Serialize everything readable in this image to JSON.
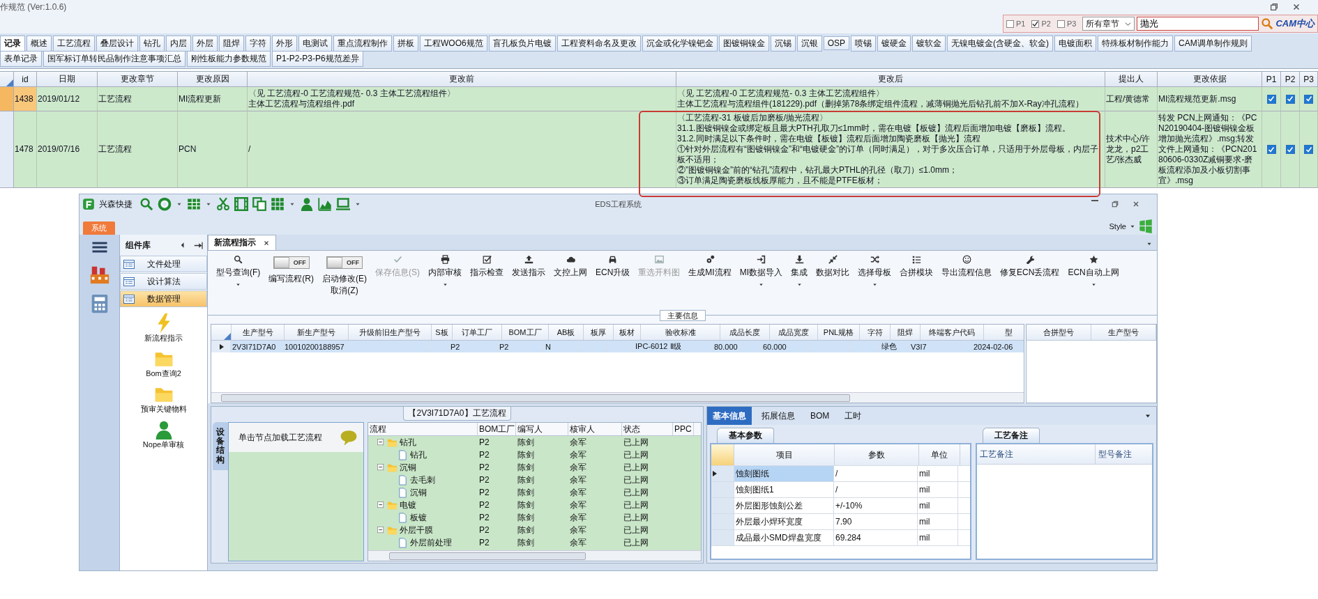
{
  "window": {
    "title": "作规范 (Ver:1.0.6)"
  },
  "filter": {
    "checks": [
      {
        "label": "P1",
        "checked": false
      },
      {
        "label": "P2",
        "checked": true
      },
      {
        "label": "P3",
        "checked": false
      }
    ],
    "chapter": "所有章节",
    "search_value": "抛光",
    "logo": "CAM中心"
  },
  "tab_rows": [
    {
      "tabs": [
        {
          "label": "记录",
          "selected": true
        },
        {
          "label": "概述",
          "selected": false
        },
        {
          "label": "工艺流程",
          "selected": false
        },
        {
          "label": "叠层设计",
          "selected": false
        },
        {
          "label": "钻孔",
          "selected": false
        },
        {
          "label": "内层",
          "selected": false
        },
        {
          "label": "外层",
          "selected": false
        },
        {
          "label": "阻焊",
          "selected": false
        },
        {
          "label": "字符",
          "selected": false
        },
        {
          "label": "外形",
          "selected": false
        },
        {
          "label": "电测试",
          "selected": false
        },
        {
          "label": "重点流程制作",
          "selected": false
        },
        {
          "label": "拼板",
          "selected": false
        },
        {
          "label": "工程WOO6规范",
          "selected": false
        },
        {
          "label": "盲孔板负片电镀",
          "selected": false
        },
        {
          "label": "工程资料命名及更改",
          "selected": false
        },
        {
          "label": "沉金或化学镍钯金",
          "selected": false
        },
        {
          "label": "图镀铜镍金",
          "selected": false
        },
        {
          "label": "沉锡",
          "selected": false
        },
        {
          "label": "沉银",
          "selected": false
        },
        {
          "label": "OSP",
          "selected": false
        },
        {
          "label": "喷锡",
          "selected": false
        },
        {
          "label": "镀硬金",
          "selected": false
        },
        {
          "label": "镀软金",
          "selected": false
        },
        {
          "label": "无镍电镀金(含硬金、软金)",
          "selected": false
        },
        {
          "label": "电镀面积",
          "selected": false
        },
        {
          "label": "特殊板材制作能力",
          "selected": false
        },
        {
          "label": "CAM调单制作规则",
          "selected": false
        }
      ]
    },
    {
      "tabs": [
        {
          "label": "表单记录",
          "selected": false
        },
        {
          "label": "国军标订单转民品制作注意事项汇总",
          "selected": false
        },
        {
          "label": "刚性板能力参数规范",
          "selected": false
        },
        {
          "label": "P1-P2-P3-P6规范差异",
          "selected": false
        }
      ]
    }
  ],
  "table": {
    "columns": [
      "id",
      "日期",
      "更改章节",
      "更改原因",
      "更改前",
      "更改后",
      "提出人",
      "更改依据",
      "P1",
      "P2",
      "P3"
    ],
    "rows": [
      {
        "selected": true,
        "boxed": false,
        "id": "1438",
        "date": "2019/01/12",
        "chapter": "工艺流程",
        "reason": "MI流程更新",
        "before": [
          "〈见 工艺流程-0 工艺流程规范- 0.3 主体工艺流程组件〉",
          "主体工艺流程与流程组件.pdf"
        ],
        "after": [
          "〈见 工艺流程-0 工艺流程规范- 0.3 主体工艺流程组件〉",
          "主体工艺流程与流程组件(181229).pdf（删掉第78条绑定组件流程，减薄铜抛光后钻孔前不加X-Ray冲孔流程）"
        ],
        "proposer": "工程/黄德常",
        "basis": "MI流程规范更新.msg",
        "p1": true,
        "p2": true,
        "p3": true
      },
      {
        "selected": false,
        "boxed": true,
        "id": "1478",
        "date": "2019/07/16",
        "chapter": "工艺流程",
        "reason": "PCN",
        "before": [
          "/"
        ],
        "after": [
          "〈工艺流程-31 板镀后加磨板/抛光流程〉",
          "31.1.图镀铜镍金或绑定板且最大PTH孔取刀≤1mm时，需在电镀【板镀】流程后面增加电镀【磨板】流程。",
          "31.2.同时满足以下条件时，需在电镀【板镀】流程后面增加陶瓷磨板【抛光】流程",
          "①针对外层流程有“图镀铜镍金”和“电镀硬金”的订单（同时满足），对于多次压合订单，只适用于外层母板，内层子板不适用；",
          "②”图镀铜镍金”前的“钻孔”流程中，钻孔最大PTHL的孔径（取刀）≤1.0mm；",
          "③订单满足陶瓷磨板线板厚能力，且不能是PTFE板材；"
        ],
        "proposer": "技术中心/许龙龙，p2工艺/张杰威",
        "basis": "转发 PCN上网通知：《PCN20190404-图镀铜镍金板增加抛光流程》.msg;转发文件上网通知：《PCN20180606-0330Z减铜要求-磨板流程添加及小板切割事宜》.msg",
        "p1": true,
        "p2": true,
        "p3": true
      }
    ]
  },
  "eds": {
    "title": "EDS工程系统",
    "quick_label": "兴森快捷",
    "menu_tab": "系统",
    "style_label": "Style",
    "panel_title": "组件库",
    "nav_items": [
      {
        "label": "文件处理",
        "selected": false
      },
      {
        "label": "设计算法",
        "selected": false
      },
      {
        "label": "数据管理",
        "selected": true
      }
    ],
    "launchers": [
      {
        "label": "新流程指示"
      },
      {
        "label": "Bom查询2"
      },
      {
        "label": "预审关键物料"
      },
      {
        "label": "Nope单审核"
      }
    ],
    "doc_tab": "新流程指示",
    "ribbon": [
      {
        "kind": "button",
        "label": "型号查询(F)",
        "disabled": false,
        "dropdown": true
      },
      {
        "kind": "toggle",
        "label": "编写流程(R)",
        "on": false,
        "state_text": "OFF"
      },
      {
        "kind": "toggle",
        "label": "启动修改(E)\n取消(Z)",
        "on": false,
        "state_text": "OFF"
      },
      {
        "kind": "button",
        "label": "保存信息(S)",
        "disabled": true,
        "dropdown": false
      },
      {
        "kind": "button",
        "label": "内部审核",
        "disabled": false,
        "dropdown": true
      },
      {
        "kind": "button",
        "label": "指示检查",
        "disabled": false,
        "dropdown": false
      },
      {
        "kind": "button",
        "label": "发送指示",
        "disabled": false,
        "dropdown": false
      },
      {
        "kind": "button",
        "label": "文控上网",
        "disabled": false,
        "dropdown": false
      },
      {
        "kind": "button",
        "label": "ECN升级",
        "disabled": false,
        "dropdown": false
      },
      {
        "kind": "button",
        "label": "重选开料图",
        "disabled": true,
        "dropdown": false
      },
      {
        "kind": "button",
        "label": "生成MI流程",
        "disabled": false,
        "dropdown": false
      },
      {
        "kind": "button",
        "label": "MI数据导入",
        "disabled": false,
        "dropdown": true
      },
      {
        "kind": "button",
        "label": "集成",
        "disabled": false,
        "dropdown": true
      },
      {
        "kind": "button",
        "label": "数据对比",
        "disabled": false,
        "dropdown": false
      },
      {
        "kind": "button",
        "label": "选择母板",
        "disabled": false,
        "dropdown": true
      },
      {
        "kind": "button",
        "label": "合拼模块",
        "disabled": false,
        "dropdown": false
      },
      {
        "kind": "button",
        "label": "导出流程信息",
        "disabled": false,
        "dropdown": false
      },
      {
        "kind": "button",
        "label": "修复ECN丢流程",
        "disabled": false,
        "dropdown": false
      },
      {
        "kind": "button",
        "label": "ECN自动上网",
        "disabled": false,
        "dropdown": true
      }
    ],
    "group_label": "主要信息",
    "main_grid": {
      "columns": [
        "生产型号",
        "新生产型号",
        "升级前旧生产型号",
        "S板",
        "订单工厂",
        "BOM工厂",
        "AB板",
        "板厚",
        "板材",
        "验收标准",
        "成品长度",
        "成品宽度",
        "PNL规格",
        "字符",
        "阻焊",
        "终端客户代码",
        "型"
      ],
      "rows": [
        {
          "selected": true,
          "cells": [
            "2V3I71D7A0",
            "10010200188957",
            "",
            "",
            "P2",
            "P2",
            "N",
            "",
            "",
            "IPC-6012 Ⅱ级",
            "80.000",
            "60.000",
            "",
            "",
            "绿色",
            "V3I7",
            "2024-02-06"
          ]
        }
      ]
    },
    "side_grid": {
      "columns": [
        "合拼型号",
        "生产型号"
      ]
    },
    "flow_panel": {
      "title": "【2V3I71D7A0】工艺流程",
      "side_tab": "设备结构",
      "hint": "单击节点加载工艺流程",
      "columns": [
        "流程",
        "BOM工厂",
        "编写人",
        "核审人",
        "状态",
        "PPC"
      ],
      "tree": [
        {
          "name": "钻孔",
          "factory": "P2",
          "writer": "陈剑",
          "reviewer": "余军",
          "status": "已上网",
          "expanded": true,
          "children": [
            {
              "name": "钻孔",
              "factory": "P2",
              "writer": "陈剑",
              "reviewer": "余军",
              "status": "已上网"
            }
          ]
        },
        {
          "name": "沉铜",
          "factory": "P2",
          "writer": "陈剑",
          "reviewer": "余军",
          "status": "已上网",
          "expanded": true,
          "children": [
            {
              "name": "去毛刺",
              "factory": "P2",
              "writer": "陈剑",
              "reviewer": "余军",
              "status": "已上网"
            },
            {
              "name": "沉铜",
              "factory": "P2",
              "writer": "陈剑",
              "reviewer": "余军",
              "status": "已上网"
            }
          ]
        },
        {
          "name": "电镀",
          "factory": "P2",
          "writer": "陈剑",
          "reviewer": "余军",
          "status": "已上网",
          "expanded": true,
          "children": [
            {
              "name": "板镀",
              "factory": "P2",
              "writer": "陈剑",
              "reviewer": "余军",
              "status": "已上网"
            }
          ]
        },
        {
          "name": "外层干膜",
          "factory": "P2",
          "writer": "陈剑",
          "reviewer": "余军",
          "status": "已上网",
          "expanded": true,
          "children": [
            {
              "name": "外层前处理",
              "factory": "P2",
              "writer": "陈剑",
              "reviewer": "余军",
              "status": "已上网"
            }
          ]
        }
      ]
    },
    "detail": {
      "tabs": [
        {
          "label": "基本信息",
          "selected": true
        },
        {
          "label": "拓展信息",
          "selected": false
        },
        {
          "label": "BOM",
          "selected": false
        },
        {
          "label": "工时",
          "selected": false
        }
      ],
      "params": {
        "tab": "基本参数",
        "columns": [
          "项目",
          "参数",
          "单位"
        ],
        "rows": [
          {
            "selected": true,
            "cells": [
              "蚀刻图纸",
              "/",
              "mil"
            ]
          },
          {
            "selected": false,
            "cells": [
              "蚀刻图纸1",
              "/",
              "mil"
            ]
          },
          {
            "selected": false,
            "cells": [
              "外层图形蚀刻公差",
              "+/-10%",
              "mil"
            ]
          },
          {
            "selected": false,
            "cells": [
              "外层最小焊环宽度",
              "7.90",
              "mil"
            ]
          },
          {
            "selected": false,
            "cells": [
              "成品最小SMD焊盘宽度",
              "69.284",
              "mil"
            ]
          }
        ]
      },
      "notes": {
        "tab": "工艺备注",
        "columns": [
          "工艺备注",
          "型号备注"
        ]
      }
    }
  }
}
